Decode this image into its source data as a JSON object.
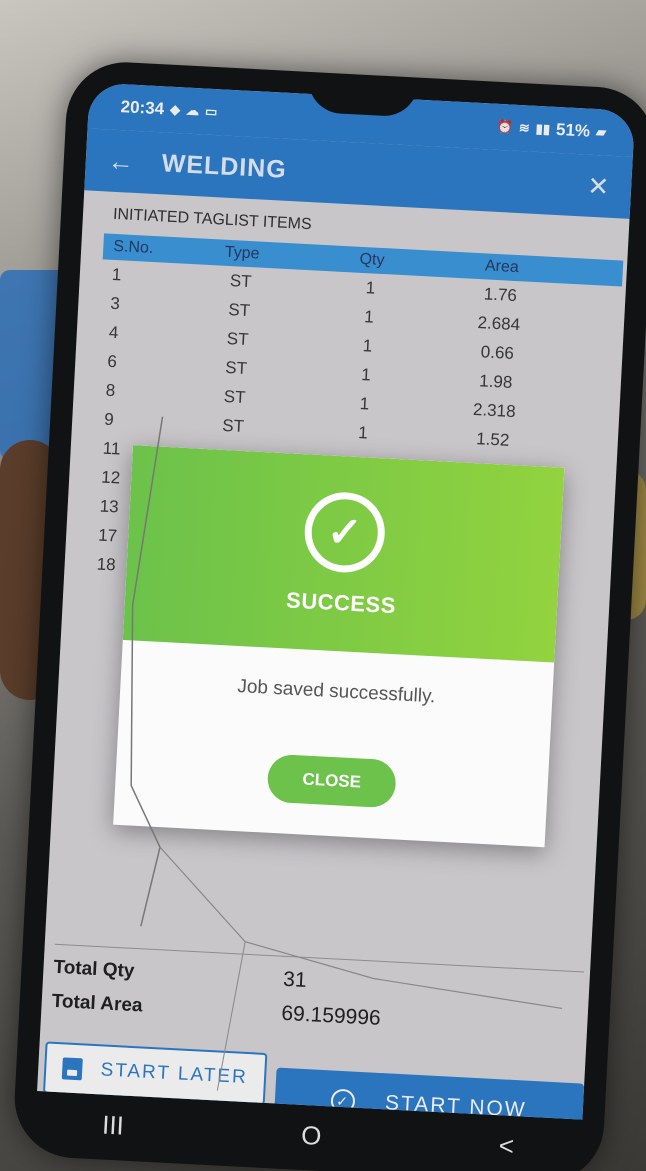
{
  "status_bar": {
    "time": "20:34",
    "battery": "51%"
  },
  "app_bar": {
    "title": "WELDING"
  },
  "section_title": "INITIATED TAGLIST ITEMS",
  "table": {
    "headers": [
      "S.No.",
      "Type",
      "Qty",
      "Area"
    ],
    "rows": [
      {
        "sno": "1",
        "type": "ST",
        "qty": "1",
        "area": "1.76"
      },
      {
        "sno": "3",
        "type": "ST",
        "qty": "1",
        "area": "2.684"
      },
      {
        "sno": "4",
        "type": "ST",
        "qty": "1",
        "area": "0.66"
      },
      {
        "sno": "6",
        "type": "ST",
        "qty": "1",
        "area": "1.98"
      },
      {
        "sno": "8",
        "type": "ST",
        "qty": "1",
        "area": "2.318"
      },
      {
        "sno": "9",
        "type": "ST",
        "qty": "1",
        "area": "1.52"
      },
      {
        "sno": "11",
        "type": "",
        "qty": "",
        "area": ""
      },
      {
        "sno": "12",
        "type": "",
        "qty": "",
        "area": ""
      },
      {
        "sno": "13",
        "type": "",
        "qty": "",
        "area": ""
      },
      {
        "sno": "17",
        "type": "",
        "qty": "",
        "area": ""
      },
      {
        "sno": "18",
        "type": "",
        "qty": "",
        "area": ""
      }
    ]
  },
  "totals": {
    "qty_label": "Total Qty",
    "area_label": "Total Area",
    "qty_value": "31",
    "area_value": "69.159996"
  },
  "actions": {
    "start_later": "START LATER",
    "start_now": "START NOW"
  },
  "dialog": {
    "title": "SUCCESS",
    "message": "Job saved successfully.",
    "close_label": "CLOSE"
  },
  "nav": {
    "recents": "III",
    "home": "O",
    "back": "<"
  },
  "colors": {
    "primary": "#2f7fd0",
    "success": "#6cc24a"
  }
}
